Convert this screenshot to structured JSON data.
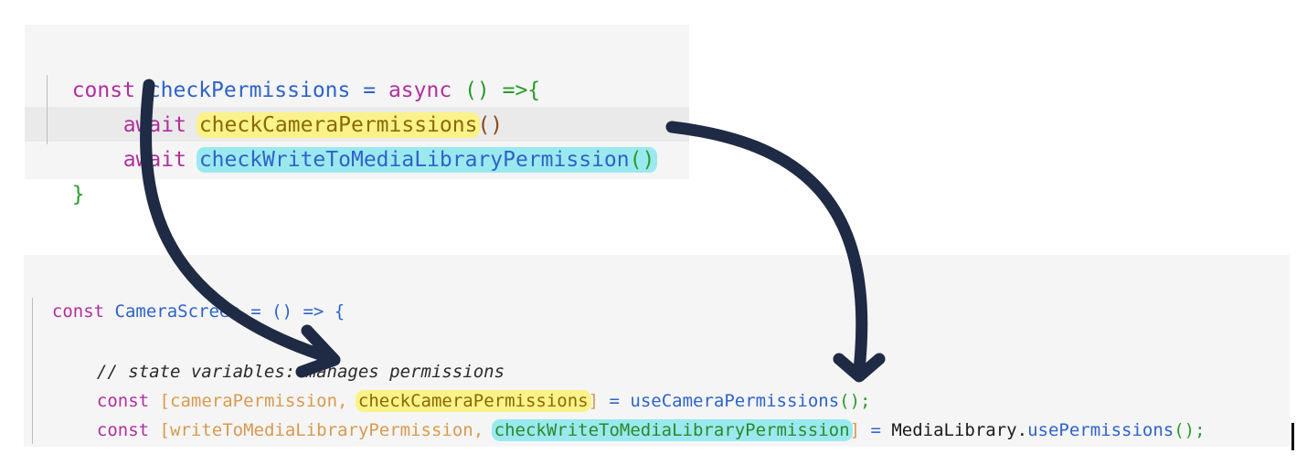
{
  "top_snippet": {
    "line1": {
      "kw_const": "const",
      "name": "checkPermissions",
      "eq": "=",
      "kw_async": "async",
      "arrow": "() =>{"
    },
    "line2": {
      "kw_await": "await",
      "call": "checkCameraPermissions",
      "parens": "()"
    },
    "line3": {
      "kw_await": "await",
      "call": "checkWriteToMediaLibraryPermission",
      "parens": "()"
    },
    "line4": {
      "close": "}"
    }
  },
  "bottom_snippet": {
    "line1": {
      "kw_const": "const",
      "name": "CameraScreen",
      "rest": "= () => {"
    },
    "comment": "// state variables: manages permissions",
    "line3": {
      "kw_const": "const",
      "open": "[",
      "var": "cameraPermission",
      "comma": ", ",
      "hook_fn": "checkCameraPermissions",
      "close": "]",
      "eq": " = ",
      "call": "useCameraPermissions",
      "call_parens": "();"
    },
    "line4": {
      "kw_const": "const",
      "open": "[",
      "var": "writeToMediaLibraryPermission",
      "comma": ", ",
      "hook_fn": "checkWriteToMediaLibraryPermission",
      "close": "]",
      "eq": " = ",
      "obj": "MediaLibrary.",
      "call": "usePermissions",
      "call_parens": "();"
    }
  },
  "colors": {
    "highlight_yellow": "#fbf28a",
    "highlight_cyan": "#9ae9ef",
    "arrow": "#1f2a44",
    "panel_bg": "#f5f5f5"
  }
}
